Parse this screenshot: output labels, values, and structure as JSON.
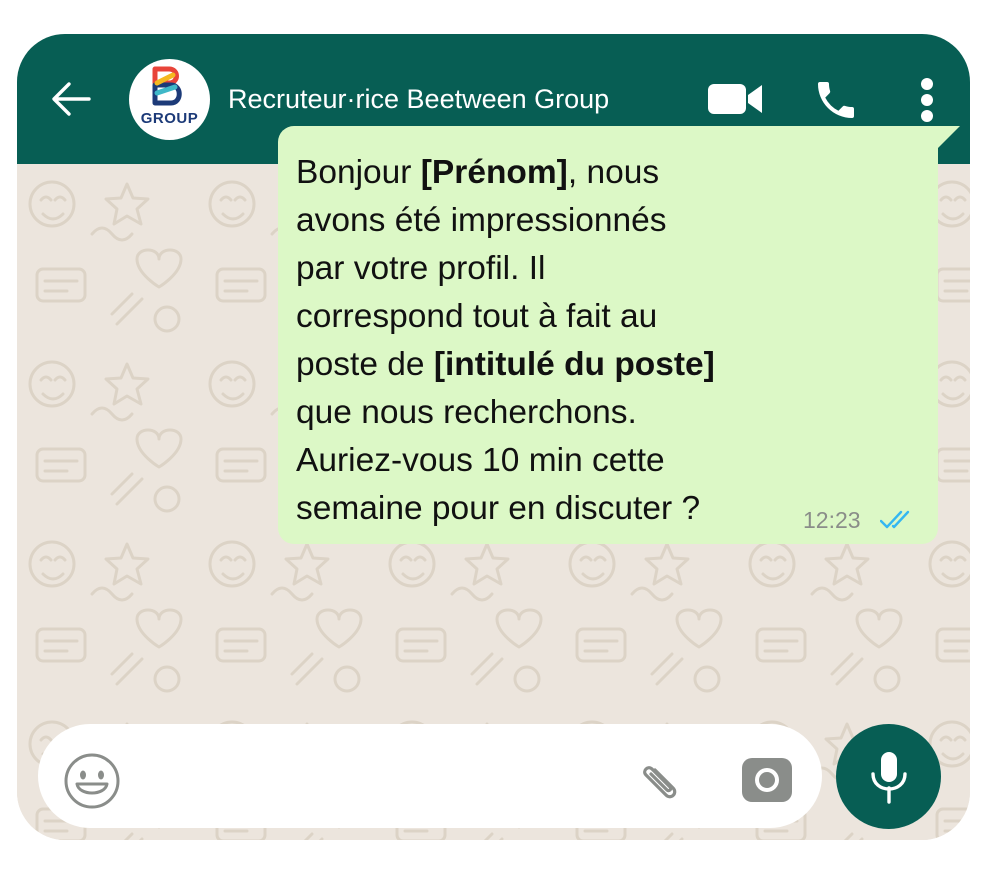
{
  "header": {
    "back_icon": "arrow-left-icon",
    "avatar_label": "GROUP",
    "contact_name": "Recruteur·rice Beetween Group",
    "video_icon": "video-camera-icon",
    "call_icon": "phone-icon",
    "menu_icon": "more-vertical-icon"
  },
  "message": {
    "segments": [
      {
        "text": "Bonjour ",
        "bold": false
      },
      {
        "text": "[Prénom]",
        "bold": true
      },
      {
        "text": ", nous\navons été impressionnés\npar votre profil. Il\ncorrespond tout à fait au\nposte de ",
        "bold": false
      },
      {
        "text": "[intitulé du poste]",
        "bold": true
      },
      {
        "text": "\nque nous recherchons.\nAuriez-vous 10 min cette\nsemaine pour en discuter ?",
        "bold": false
      }
    ],
    "time": "12:23",
    "status_icon": "double-check-icon",
    "status_color": "#34b7f1"
  },
  "input": {
    "placeholder": "",
    "emoji_icon": "emoji-icon",
    "attach_icon": "paperclip-icon",
    "camera_icon": "camera-icon",
    "mic_icon": "microphone-icon"
  },
  "colors": {
    "header": "#075e54",
    "bubble": "#dcf8c6",
    "chat_bg": "#ece5dd"
  }
}
